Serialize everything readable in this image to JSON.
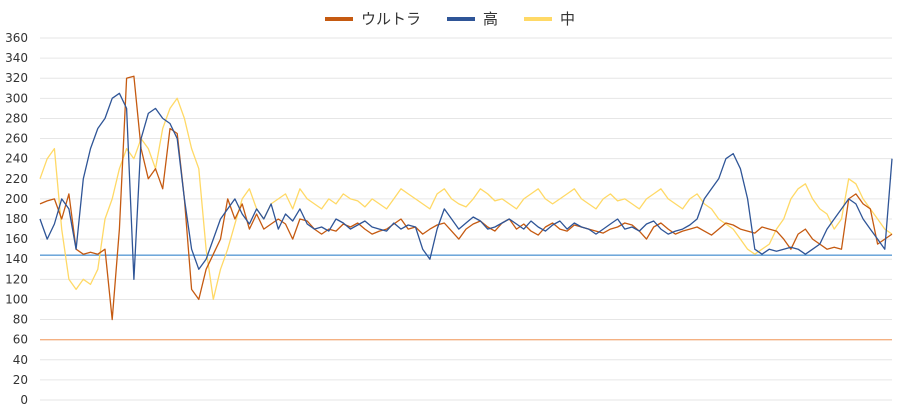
{
  "chart_data": {
    "type": "line",
    "title": "",
    "xlabel": "",
    "ylabel": "",
    "ylim": [
      0,
      360
    ],
    "yticks": [
      0,
      20,
      40,
      60,
      80,
      100,
      120,
      140,
      160,
      180,
      200,
      220,
      240,
      260,
      280,
      300,
      320,
      340,
      360
    ],
    "grid": true,
    "legend_position": "top",
    "reference_lines": [
      {
        "value": 144,
        "color": "#5b9bd5"
      },
      {
        "value": 60,
        "color": "#f4b183"
      }
    ],
    "series": [
      {
        "name": "ウルトラ",
        "color": "#c55a11",
        "values": [
          195,
          198,
          200,
          180,
          205,
          150,
          145,
          147,
          145,
          150,
          80,
          170,
          320,
          322,
          250,
          220,
          230,
          210,
          270,
          265,
          200,
          110,
          100,
          130,
          145,
          160,
          200,
          180,
          195,
          170,
          185,
          170,
          175,
          180,
          175,
          160,
          180,
          178,
          170,
          165,
          170,
          168,
          175,
          172,
          176,
          170,
          165,
          168,
          170,
          175,
          180,
          170,
          172,
          165,
          170,
          174,
          176,
          168,
          160,
          170,
          175,
          178,
          172,
          168,
          176,
          180,
          170,
          175,
          168,
          164,
          172,
          176,
          170,
          168,
          174,
          172,
          170,
          168,
          166,
          170,
          172,
          176,
          174,
          168,
          160,
          172,
          176,
          170,
          165,
          168,
          170,
          172,
          168,
          164,
          170,
          176,
          174,
          170,
          168,
          166,
          172,
          170,
          168,
          160,
          150,
          165,
          170,
          160,
          155,
          150,
          152,
          150,
          200,
          205,
          195,
          190,
          155,
          160,
          165
        ]
      },
      {
        "name": "高",
        "color": "#2f5597",
        "values": [
          180,
          160,
          175,
          200,
          190,
          150,
          220,
          250,
          270,
          280,
          300,
          305,
          290,
          120,
          260,
          285,
          290,
          280,
          275,
          260,
          200,
          150,
          130,
          140,
          160,
          180,
          190,
          200,
          185,
          175,
          190,
          180,
          195,
          170,
          185,
          178,
          190,
          175,
          170,
          172,
          168,
          180,
          176,
          170,
          174,
          178,
          172,
          170,
          168,
          176,
          170,
          174,
          172,
          150,
          140,
          170,
          190,
          180,
          170,
          176,
          182,
          178,
          170,
          172,
          176,
          180,
          175,
          170,
          178,
          172,
          168,
          174,
          178,
          170,
          176,
          172,
          170,
          165,
          170,
          175,
          180,
          170,
          172,
          168,
          175,
          178,
          170,
          165,
          168,
          170,
          174,
          180,
          200,
          210,
          220,
          240,
          245,
          230,
          200,
          150,
          145,
          150,
          148,
          150,
          152,
          150,
          145,
          150,
          155,
          170,
          180,
          190,
          200,
          195,
          180,
          170,
          160,
          150,
          240
        ]
      },
      {
        "name": "中",
        "color": "#ffd966",
        "values": [
          220,
          240,
          250,
          170,
          120,
          110,
          120,
          115,
          130,
          180,
          200,
          230,
          250,
          240,
          260,
          250,
          230,
          270,
          290,
          300,
          280,
          250,
          230,
          150,
          100,
          130,
          150,
          175,
          200,
          210,
          190,
          180,
          195,
          200,
          205,
          190,
          210,
          200,
          195,
          190,
          200,
          195,
          205,
          200,
          198,
          192,
          200,
          195,
          190,
          200,
          210,
          205,
          200,
          195,
          190,
          205,
          210,
          200,
          195,
          192,
          200,
          210,
          205,
          198,
          200,
          195,
          190,
          200,
          205,
          210,
          200,
          195,
          200,
          205,
          210,
          200,
          195,
          190,
          200,
          205,
          198,
          200,
          195,
          190,
          200,
          205,
          210,
          200,
          195,
          190,
          200,
          205,
          195,
          190,
          180,
          175,
          170,
          160,
          150,
          145,
          150,
          155,
          170,
          180,
          200,
          210,
          215,
          200,
          190,
          185,
          170,
          180,
          220,
          215,
          200,
          190,
          180,
          170,
          165
        ]
      }
    ]
  }
}
